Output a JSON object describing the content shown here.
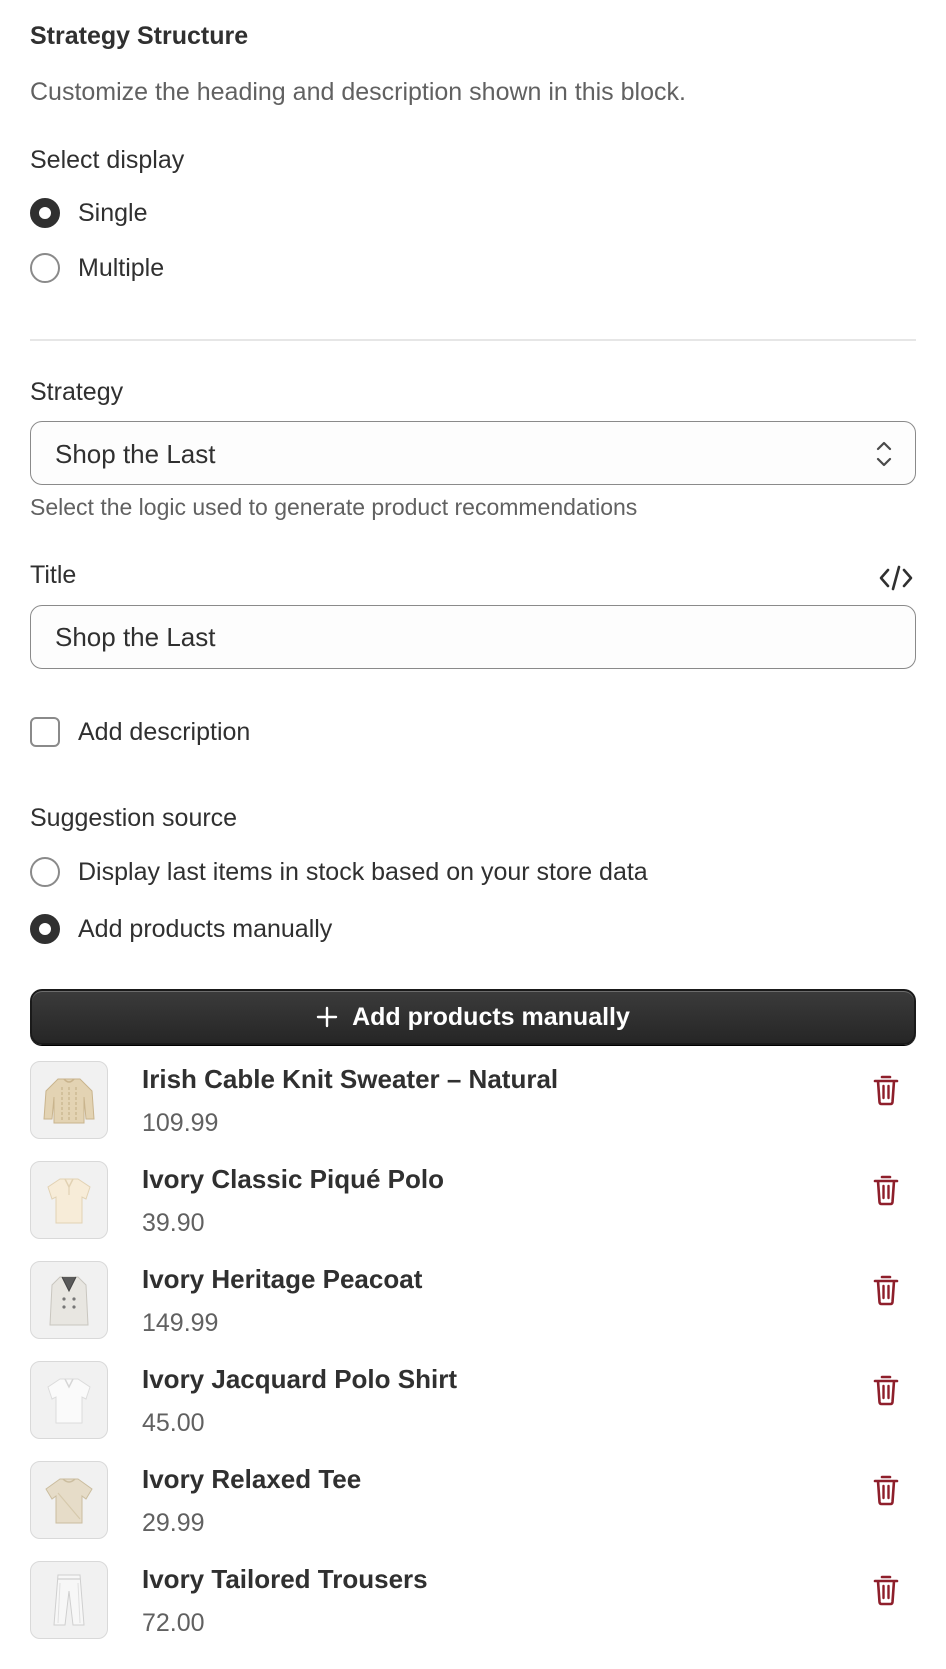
{
  "section": {
    "title": "Strategy Structure",
    "description": "Customize the heading and description shown in this block."
  },
  "display": {
    "label": "Select display",
    "options": [
      {
        "label": "Single",
        "selected": true
      },
      {
        "label": "Multiple",
        "selected": false
      }
    ]
  },
  "strategy": {
    "label": "Strategy",
    "value": "Shop the Last",
    "help": "Select the logic used to generate product recommendations"
  },
  "title_field": {
    "label": "Title",
    "value": "Shop the Last"
  },
  "description_toggle": {
    "label": "Add description",
    "checked": false
  },
  "suggestion": {
    "label": "Suggestion source",
    "options": [
      {
        "label": "Display last items in stock based on your store data",
        "selected": false
      },
      {
        "label": "Add products manually",
        "selected": true
      }
    ]
  },
  "add_button": {
    "label": "Add products manually"
  },
  "products": [
    {
      "name": "Irish Cable Knit Sweater – Natural",
      "price": "109.99",
      "thumb": "sweater"
    },
    {
      "name": "Ivory Classic Piqué Polo",
      "price": "39.90",
      "thumb": "polo"
    },
    {
      "name": "Ivory Heritage Peacoat",
      "price": "149.99",
      "thumb": "coat"
    },
    {
      "name": "Ivory Jacquard Polo Shirt",
      "price": "45.00",
      "thumb": "polo-white"
    },
    {
      "name": "Ivory Relaxed Tee",
      "price": "29.99",
      "thumb": "tee"
    },
    {
      "name": "Ivory Tailored Trousers",
      "price": "72.00",
      "thumb": "trousers"
    }
  ],
  "colors": {
    "primary": "#303030",
    "delete": "#8e1f2b",
    "muted": "#616161"
  },
  "icons": {
    "code": "code-icon",
    "chevron": "select-chevron-icon",
    "plus": "plus-icon",
    "delete": "trash-icon"
  }
}
